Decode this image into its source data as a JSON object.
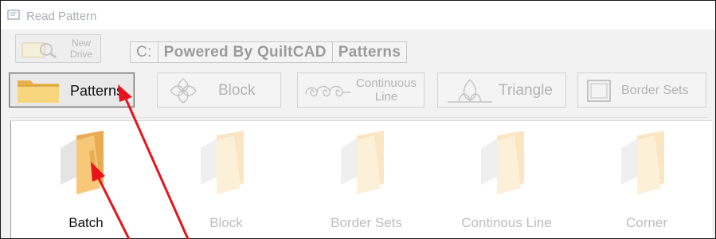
{
  "window": {
    "title": "Read Pattern"
  },
  "toolbar": {
    "new_drive_label": "New\nDrive"
  },
  "path": {
    "segments": [
      "C:",
      "Powered By QuiltCAD",
      "Patterns"
    ]
  },
  "tabs": [
    {
      "label": "Patterns",
      "active": true,
      "icon": "folder-icon"
    },
    {
      "label": "Block",
      "active": false,
      "icon": "block-knot-icon"
    },
    {
      "label": "Continuous\nLine",
      "active": false,
      "icon": "continuous-line-icon"
    },
    {
      "label": "Triangle",
      "active": false,
      "icon": "triangle-knot-icon"
    },
    {
      "label": "Border Sets",
      "active": false,
      "icon": "border-sets-icon"
    }
  ],
  "folders": [
    {
      "name": "Batch",
      "active": true
    },
    {
      "name": "Block",
      "active": false
    },
    {
      "name": "Border Sets",
      "active": false
    },
    {
      "name": "Continous Line",
      "active": false
    },
    {
      "name": "Corner",
      "active": false
    }
  ],
  "colors": {
    "annotation_arrow": "#e8131c",
    "folder_active": "#f1c46a",
    "folder_faded": "#fdf0d8"
  }
}
